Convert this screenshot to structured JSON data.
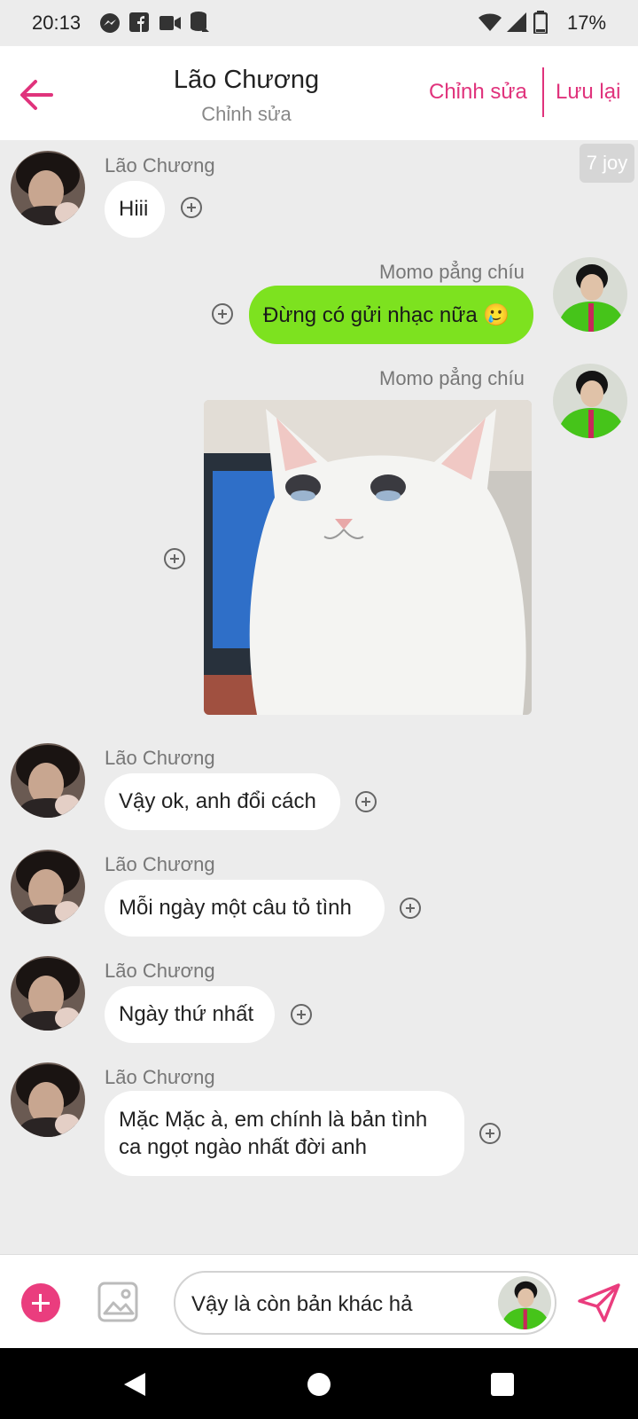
{
  "status_bar": {
    "time": "20:13",
    "battery": "17%",
    "icons": [
      "messenger-icon",
      "facebook-icon",
      "video-icon",
      "database-icon",
      "wifi-icon",
      "signal-icon",
      "battery-icon"
    ]
  },
  "header": {
    "title": "Lão Chương",
    "subtitle": "Chỉnh sửa",
    "edit_label": "Chỉnh sửa",
    "save_label": "Lưu lại",
    "accent_color": "#e0337c"
  },
  "badge": "7 joy",
  "messages": [
    {
      "sender": "Lão Chương",
      "side": "left",
      "text": "Hiii"
    },
    {
      "sender": "Momo pẳng chíu",
      "side": "right",
      "text": "Đừng có gửi nhạc nữa 🥲"
    },
    {
      "sender": "Momo pẳng chíu",
      "side": "right",
      "image": "crying-cat-meme"
    },
    {
      "sender": "Lão Chương",
      "side": "left",
      "text": "Vậy ok, anh đổi cách"
    },
    {
      "sender": "Lão Chương",
      "side": "left",
      "text": "Mỗi ngày một câu tỏ tình"
    },
    {
      "sender": "Lão Chương",
      "side": "left",
      "text": "Ngày thứ nhất"
    },
    {
      "sender": "Lão Chương",
      "side": "left",
      "text_line1": "Mặc Mặc à, em chính là bản tình",
      "text_line2": "ca ngọt ngào nhất đời anh"
    }
  ],
  "composer": {
    "input_value": "Vậy là còn bản khác hả",
    "accent_color": "#ea3d7e"
  }
}
